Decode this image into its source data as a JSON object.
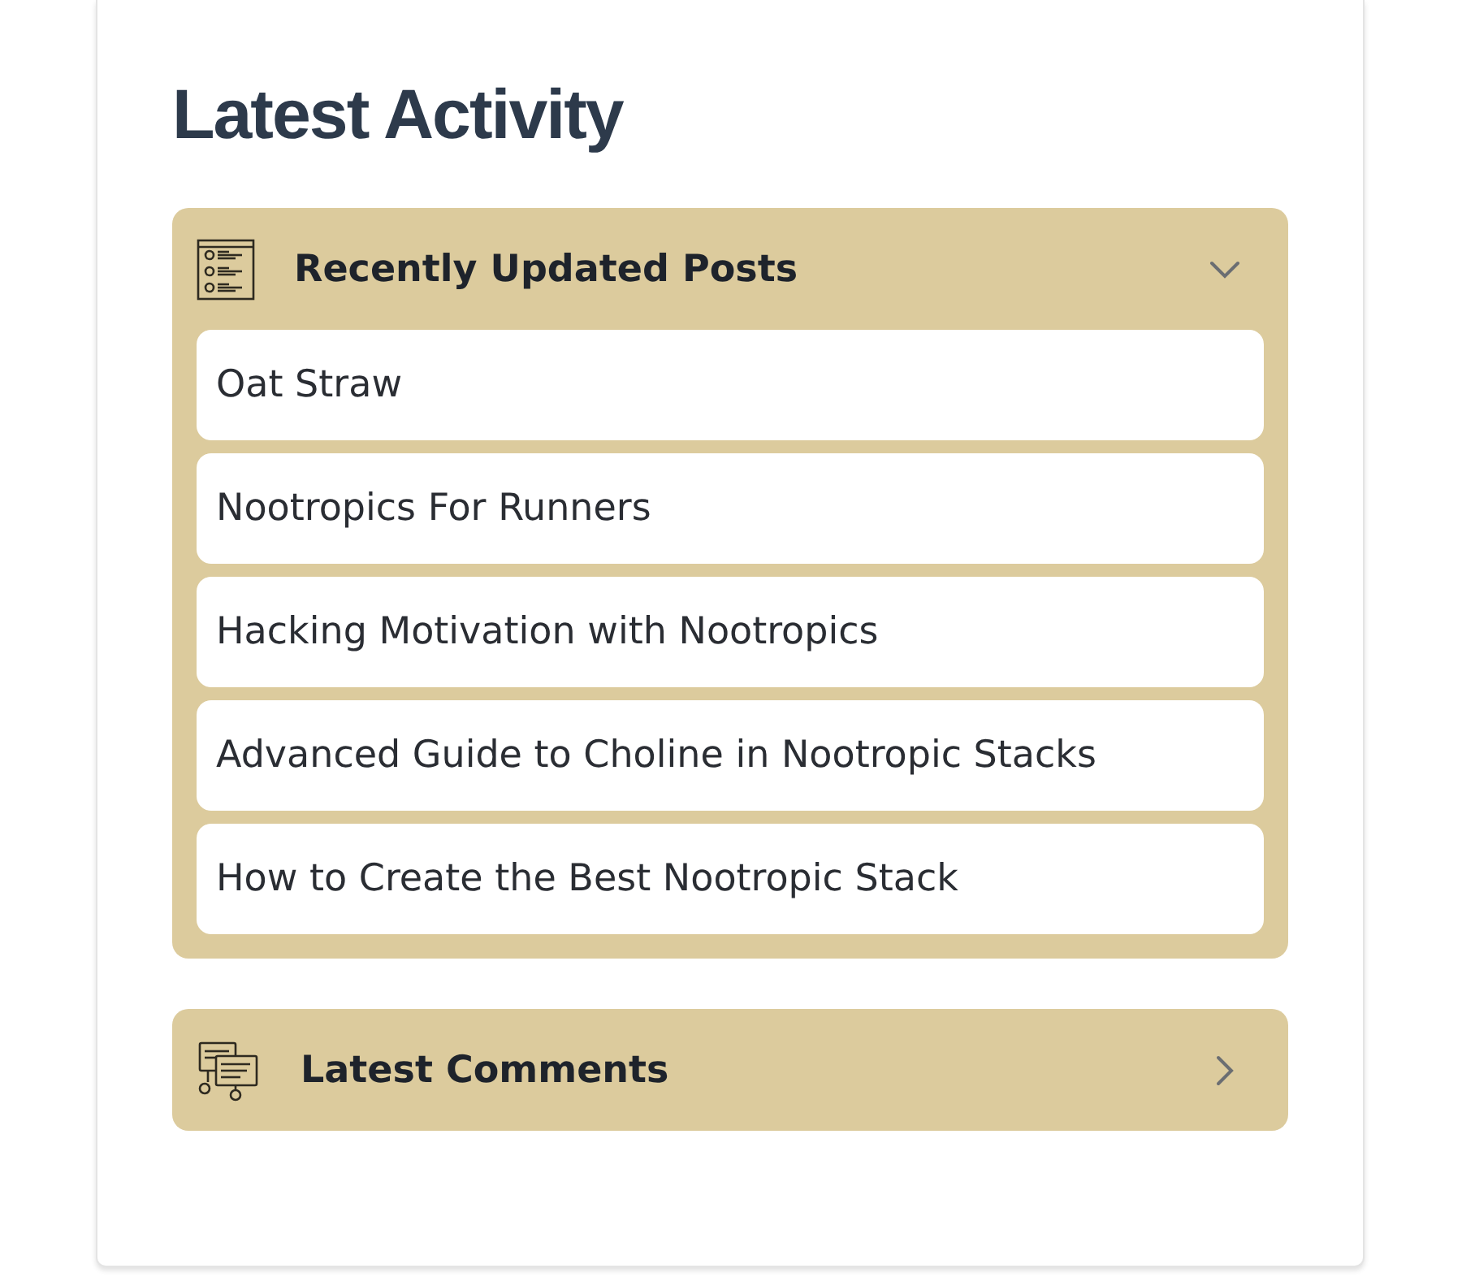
{
  "title": "Latest Activity",
  "sections": [
    {
      "title": "Recently Updated Posts",
      "kind": "posts",
      "expanded": true,
      "items": [
        "Oat Straw",
        "Nootropics For Runners",
        "Hacking Motivation with Nootropics",
        "Advanced Guide to Choline in Nootropic Stacks",
        "How to Create the Best Nootropic Stack"
      ]
    },
    {
      "title": "Latest Comments",
      "kind": "comments",
      "expanded": false
    }
  ]
}
